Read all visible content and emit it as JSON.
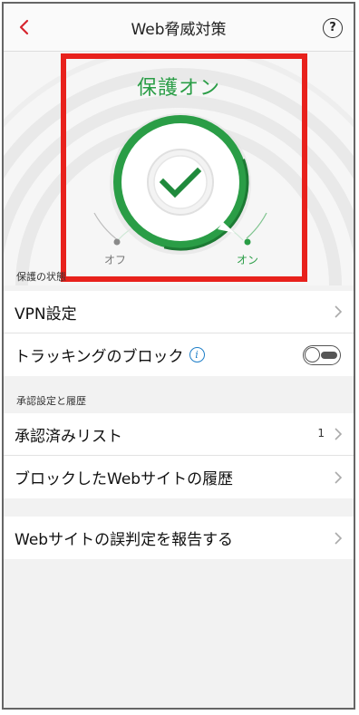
{
  "header": {
    "title": "Web脅威対策",
    "back_icon": "chevron-left-icon",
    "help_label": "?"
  },
  "hero": {
    "status": "保護オン",
    "off_label": "オフ",
    "on_label": "オン",
    "state": "on",
    "accent_color": "#2a9d46"
  },
  "sections": [
    {
      "title": "保護の状態",
      "items": [
        {
          "label": "VPN設定",
          "type": "link"
        },
        {
          "label": "トラッキングのブロック",
          "type": "toggle",
          "value": false,
          "info": "i"
        }
      ]
    },
    {
      "title": "承認設定と履歴",
      "items": [
        {
          "label": "承認済みリスト",
          "type": "link",
          "count": "1"
        },
        {
          "label": "ブロックしたWebサイトの履歴",
          "type": "link"
        }
      ]
    },
    {
      "title": "",
      "items": [
        {
          "label": "Webサイトの誤判定を報告する",
          "type": "link"
        }
      ]
    }
  ],
  "colors": {
    "brand_red": "#e8211c",
    "green": "#2a9d46",
    "info_blue": "#1e7ec8"
  }
}
